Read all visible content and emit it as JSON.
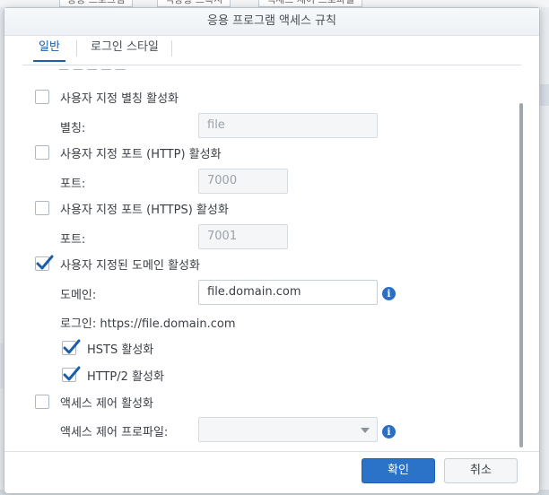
{
  "background": {
    "tabs": [
      "응용 프로그램",
      "역방향 프록시",
      "액세스 제어 프로파일"
    ]
  },
  "dialog": {
    "title": "응용 프로그램 액세스 규칙",
    "tabs": [
      {
        "label": "일반",
        "active": true
      },
      {
        "label": "로그인 스타일",
        "active": false
      }
    ],
    "partial_text": "— — — — —",
    "alias": {
      "checkbox_label": "사용자 지정 별칭 활성화",
      "checked": false,
      "field_label": "별칭:",
      "value": "file"
    },
    "http_port": {
      "checkbox_label": "사용자 지정 포트 (HTTP) 활성화",
      "checked": false,
      "field_label": "포트:",
      "value": "7000"
    },
    "https_port": {
      "checkbox_label": "사용자 지정 포트 (HTTPS) 활성화",
      "checked": false,
      "field_label": "포트:",
      "value": "7001"
    },
    "domain": {
      "checkbox_label": "사용자 지정된 도메인 활성화",
      "checked": true,
      "field_label": "도메인:",
      "value": "file.domain.com",
      "login_text": "로그인: https://file.domain.com",
      "hsts_label": "HSTS 활성화",
      "hsts_checked": true,
      "http2_label": "HTTP/2 활성화",
      "http2_checked": true
    },
    "access_control": {
      "checkbox_label": "액세스 제어 활성화",
      "checked": false,
      "field_label": "액세스 제어 프로파일:",
      "value": ""
    },
    "buttons": {
      "ok": "확인",
      "cancel": "취소"
    }
  },
  "colors": {
    "accent": "#2b73c9",
    "info_icon": "#2a6fc4",
    "check": "#1c5ea8"
  }
}
